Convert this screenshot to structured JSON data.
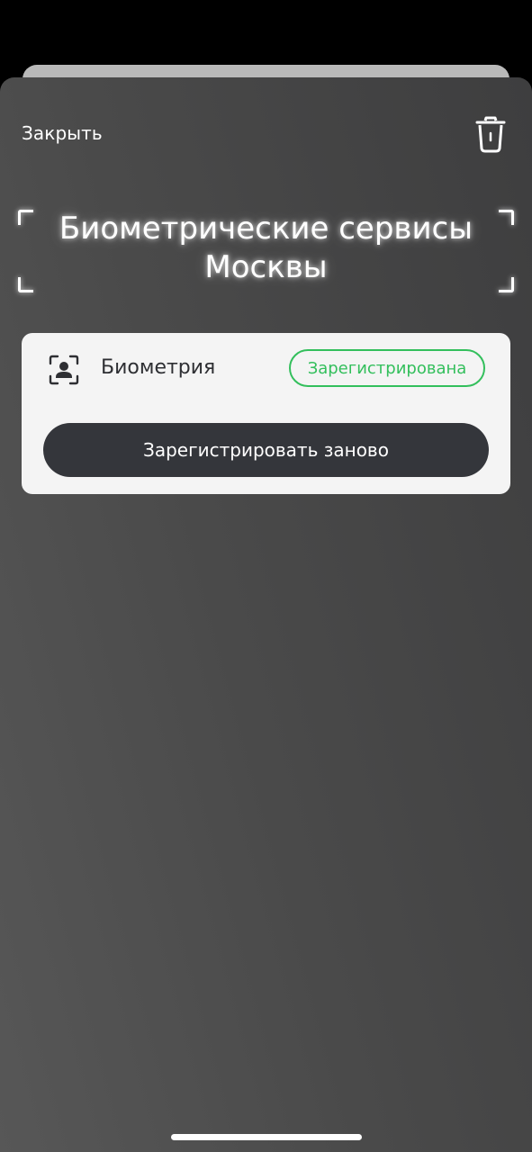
{
  "header": {
    "close_label": "Закрыть",
    "delete_icon": "trash-icon"
  },
  "title": {
    "line1": "Биометрические сервисы",
    "line2": "Москвы"
  },
  "card": {
    "icon": "face-scan-icon",
    "label": "Биометрия",
    "status": "Зарегистрирована",
    "button_label": "Зарегистрировать заново"
  },
  "colors": {
    "status_green": "#33bf5c",
    "button_dark": "#34363b",
    "card_background": "#f4f4f4",
    "sheet_background": "#4a4a4a"
  }
}
